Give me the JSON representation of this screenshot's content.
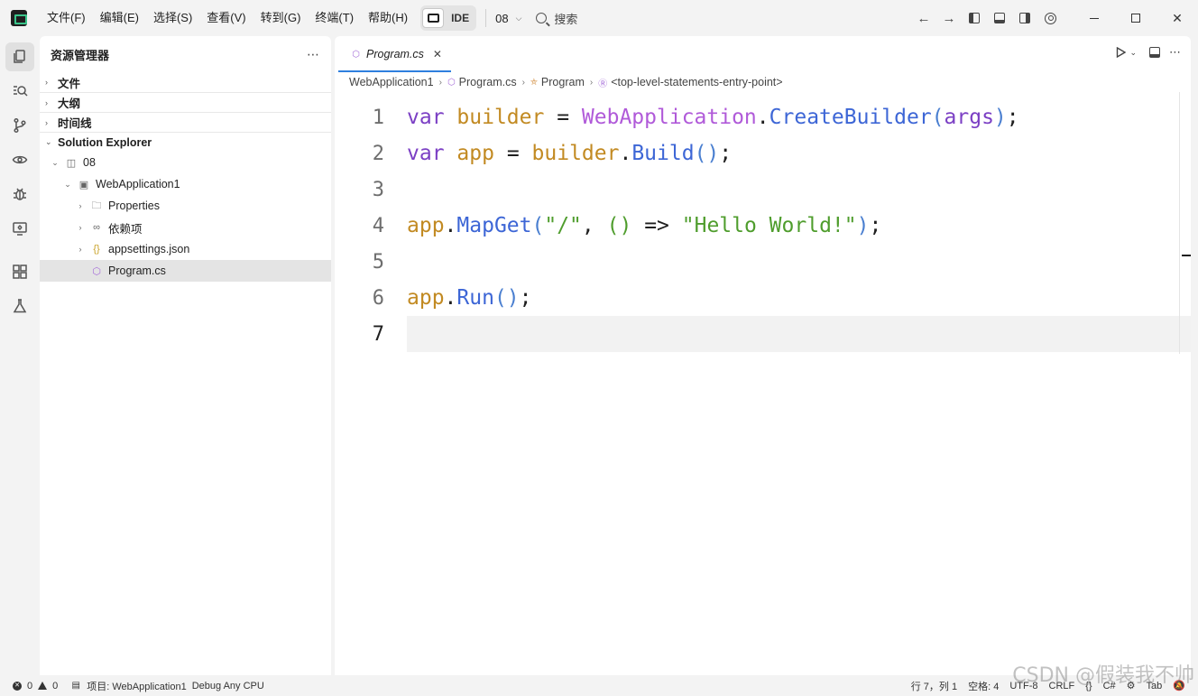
{
  "menu": [
    "文件(F)",
    "编辑(E)",
    "选择(S)",
    "查看(V)",
    "转到(G)",
    "终端(T)",
    "帮助(H)"
  ],
  "ide_label": "IDE",
  "workspace": "08",
  "search_label": "搜索",
  "explorer": {
    "title": "资源管理器",
    "sections": [
      "文件",
      "大纲",
      "时间线",
      "Solution Explorer"
    ],
    "tree": [
      {
        "label": "08"
      },
      {
        "label": "WebApplication1"
      },
      {
        "label": "Properties"
      },
      {
        "label": "依赖项"
      },
      {
        "label": "appsettings.json"
      },
      {
        "label": "Program.cs"
      }
    ]
  },
  "editor": {
    "tab": "Program.cs",
    "breadcrumb": [
      "WebApplication1",
      "Program.cs",
      "Program",
      "<top-level-statements-entry-point>"
    ],
    "line_numbers": [
      "1",
      "2",
      "3",
      "4",
      "5",
      "6",
      "7"
    ]
  },
  "status": {
    "errors": "0",
    "warnings": "0",
    "project": "项目: WebApplication1",
    "config": "Debug Any CPU",
    "position": "行 7，列 1",
    "spaces": "空格: 4",
    "encoding": "UTF-8",
    "eol": "CRLF",
    "language": "C#",
    "indent": "Tab"
  },
  "watermark": "CSDN @假装我不帅",
  "colors": {
    "accent": "#2f7fde",
    "keyword": "#7b3fc4",
    "variable": "#c28a22",
    "type": "#b05ad9",
    "function": "#3d66d6",
    "string": "#4f9d2d"
  }
}
